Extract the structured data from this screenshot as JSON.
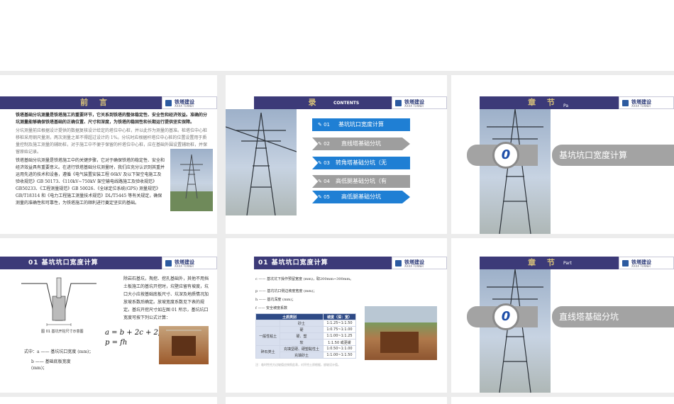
{
  "slides": {
    "s1": {
      "title": "前 言",
      "logo_text": "铁塔建设",
      "logo_sub": "XXXX TOWER",
      "p1": "铁塔基础分坑测量是铁塔施工的重要环节，它关系到铁塔的整体稳定性、安全性和经济效益。准确的分坑测量能够确保铁塔基础的正确位置、尺寸和深度，为铁塔的稳固性和长期运行提供坚实保障。",
      "p2": "分坑测量前应根据设计提供的数据复核设计给定的塔位中心桩，并以此作为测量的基准。桩塔位中心桩移桩采用钢尺量测，两次测量之差不得超过设计的 1%。分坑时应根据杆塔位中心桩的位置设置用于质量控制及施工测量的辅助桩，对于施工中不便于保留的杆塔位中心桩，应在基础外围设置辅助桩，并保留原始记录。",
      "p3": "铁塔基础分坑测量是铁塔施工中的关键步骤，它对于确保铁塔的稳定性、安全和经济效益具有重要意义。在进行铁塔基础分坑测量时，我们应充分认识到其重并运用先进的技术和设备，遵循《电气装置安装工程 66kV 及以下架空电施工及验收规范》GB 50173、《110kV~750kV 架空输电线路施工及验收规范》GB50233、《工程测量规范》GB 50026、《全球定位系统(GPS) 测量规范》GB/T18314 和《电力工程施工测量技术规范》DL/T5445 等有关规定，确保测量的准确性和可靠性，为铁塔施工的顺利进行奠定坚实的基础。"
    },
    "s2": {
      "title": "录",
      "subtitle": "CONTENTS",
      "items": [
        {
          "icon": "01",
          "label": "基坑坑口宽度计算",
          "color": "#1f7fd4"
        },
        {
          "icon": "02",
          "label": "直线塔基础分坑",
          "color": "#9e9e9e"
        },
        {
          "icon": "03",
          "label": "转角塔基础分坑（无",
          "color": "#1f7fd4"
        },
        {
          "icon": "04",
          "label": "高低腿基础分坑（有",
          "color": "#9e9e9e"
        },
        {
          "icon": "05",
          "label": "高低腿基础分坑",
          "color": "#1f7fd4"
        }
      ]
    },
    "s3": {
      "title": "章 节",
      "part": "Pa",
      "number": "0",
      "label": "基坑坑口宽度计算"
    },
    "s4": {
      "title": "01 基坑坑口宽度计算",
      "body": "除岩石基坑，掏挖、挖孔基础外，其他不用挡土板施工的基坑开挖时，坑壁应留有坡度，坑口大小应按基础底板尺寸、坑深及地质情况加放坡系数后确定。放坡宽度系数见下表的规定。基坑开挖尺寸如左图 01 所示，基坑坑口宽度可按下列公式计算：",
      "fig_caption": "图 01 基坑开挖尺寸示意图",
      "formula1": "a = b + 2c + 2p",
      "formula2": "p = fh",
      "where_a": "式中：a —— 基坑坑口宽度 (mm)；",
      "where_b": "b —— 基础底板宽度",
      "where_b2": "(mm)；"
    },
    "s5": {
      "title": "01 基坑坑口宽度计算",
      "c_line": "c —— 基坑坑下操作预留宽度 (mm)，取200mm~300mm。",
      "p_line": "p —— 基坑坑口侧边坡度宽度 (mm)；",
      "h_line": "h —— 基坑深度 (mm)；",
      "f_line": "f —— 安全坡度系数",
      "table_header": [
        "土质类别",
        "坡度（深：宽）"
      ],
      "table_rows": [
        [
          "",
          "砂土",
          "1:1.25~1:1.50"
        ],
        [
          "一般性粘土",
          "硬",
          "1:0.75~1:1.00"
        ],
        [
          "",
          "硬、塑",
          "1:1.00~1:1.25"
        ],
        [
          "",
          "软",
          "1:1.50 或更缓"
        ],
        [
          "碎石类土",
          "充填坚硬、硬塑黏性土",
          "1:0.50~1:1.00"
        ],
        [
          "",
          "充填砂土",
          "1:1.00~1:1.50"
        ]
      ],
      "note": "注：临时性挖方边坡值应按照此表，对开挖土质根据，放坡设计值。"
    },
    "s6": {
      "title": "章 节",
      "part": "Part",
      "number": "0",
      "label": "直线塔基础分坑"
    }
  }
}
